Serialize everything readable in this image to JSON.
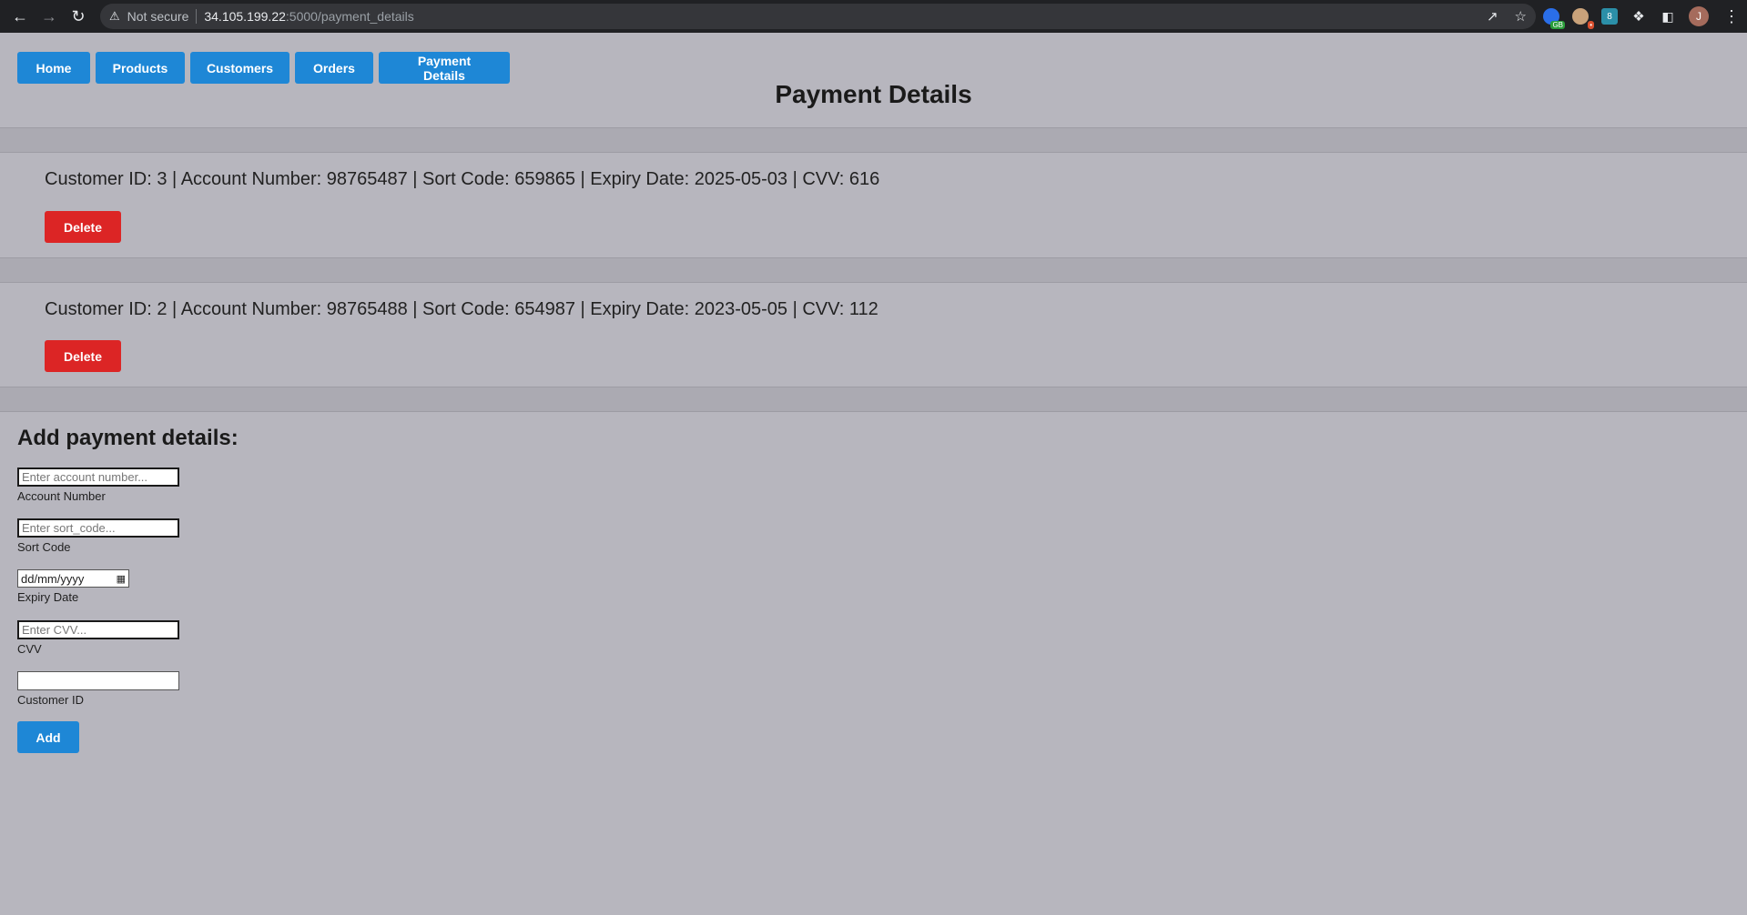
{
  "browser": {
    "security_label": "Not secure",
    "url_host": "34.105.199.22",
    "url_path": ":5000/payment_details",
    "ext_badge_1": "GB",
    "ext_badge_3": "8",
    "avatar_letter": "J"
  },
  "nav": {
    "items": [
      {
        "label": "Home"
      },
      {
        "label": "Products"
      },
      {
        "label": "Customers"
      },
      {
        "label": "Orders"
      },
      {
        "label": "Payment Details"
      }
    ]
  },
  "page": {
    "title": "Payment Details"
  },
  "records": [
    {
      "text": "Customer ID: 3 | Account Number: 98765487 | Sort Code: 659865 | Expiry Date: 2025-05-03 | CVV: 616",
      "delete_label": "Delete"
    },
    {
      "text": "Customer ID: 2 | Account Number: 98765488 | Sort Code: 654987 | Expiry Date: 2023-05-05 | CVV: 112",
      "delete_label": "Delete"
    }
  ],
  "form": {
    "title": "Add payment details:",
    "account_number": {
      "placeholder": "Enter account number...",
      "label": "Account Number"
    },
    "sort_code": {
      "placeholder": "Enter sort_code...",
      "label": "Sort Code"
    },
    "expiry_date": {
      "value": "dd/mm/yyyy",
      "label": "Expiry Date"
    },
    "cvv": {
      "placeholder": "Enter CVV...",
      "label": "CVV"
    },
    "customer_id": {
      "value": "",
      "label": "Customer ID"
    },
    "submit_label": "Add"
  },
  "colors": {
    "page_background": "#b7b6be",
    "primary_button": "#1e87d6",
    "danger_button": "#dc2525"
  }
}
